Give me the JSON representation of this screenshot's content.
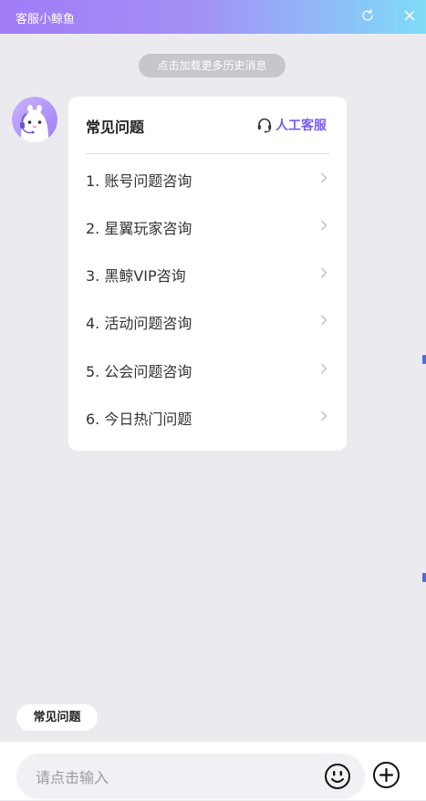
{
  "header": {
    "title": "客服小鲸鱼",
    "icons": [
      "refresh-icon",
      "close-icon"
    ]
  },
  "history_label": "点击加载更多历史消息",
  "faq_card": {
    "title": "常见问题",
    "agent_label": "人工客服",
    "items": [
      "1. 账号问题咨询",
      "2. 星翼玩家咨询",
      "3. 黑鲸VIP咨询",
      "4. 活动问题咨询",
      "5. 公会问题咨询",
      "6. 今日热门问题"
    ]
  },
  "quick_chip": "常见问题",
  "composer": {
    "placeholder": "请点击输入",
    "icons": [
      "emoji-icon",
      "plus-icon"
    ]
  },
  "colors": {
    "accent": "#7a5cf0",
    "header_gradient_start": "#a07cf7",
    "header_gradient_end": "#7fdcf8",
    "background": "#ebebef"
  }
}
